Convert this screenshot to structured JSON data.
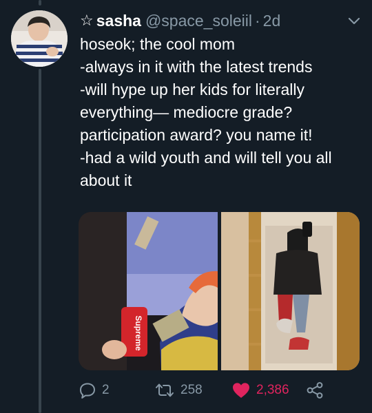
{
  "tweet": {
    "display_name": "sasha",
    "handle": "@space_soleiil",
    "separator": "·",
    "time": "2d",
    "lines": [
      "hoseok; the cool mom",
      "-always in it with the latest trends",
      "-will hype up her kids for literally",
      "everything— mediocre grade?",
      "participation award? you name it!",
      "-had a wild youth and will tell you all",
      "about it"
    ],
    "media": {
      "left_label": "Supreme"
    },
    "actions": {
      "replies": "2",
      "retweets": "258",
      "likes": "2,386"
    },
    "icons": {
      "name_prefix": "star-outline-icon",
      "more": "chevron-down-icon",
      "reply": "reply-bubble-icon",
      "retweet": "retweet-icon",
      "like": "heart-icon",
      "share": "share-icon"
    },
    "colors": {
      "background": "#141d26",
      "muted": "#8899a6",
      "like": "#e0245e"
    }
  }
}
